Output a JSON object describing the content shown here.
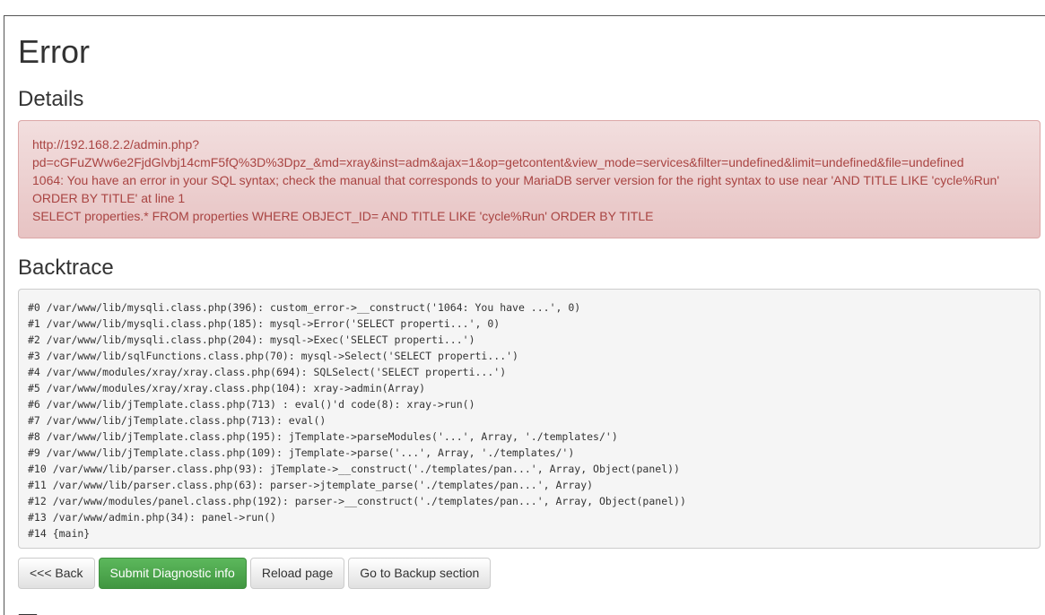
{
  "page": {
    "title": "Error",
    "details_heading": "Details",
    "backtrace_heading": "Backtrace",
    "next_heading_partial": "T"
  },
  "error_alert": {
    "url_line1": "http://192.168.2.2/admin.php?",
    "url_line2": "pd=cGFuZWw6e2FjdGlvbj14cmF5fQ%3D%3Dpz_&md=xray&inst=adm&ajax=1&op=getcontent&view_mode=services&filter=undefined&limit=undefined&file=undefined",
    "message_line1": "1064: You have an error in your SQL syntax; check the manual that corresponds to your MariaDB server version for the right syntax to use near 'AND TITLE LIKE 'cycle%Run'",
    "message_line2": "ORDER BY TITLE' at line 1",
    "query": "SELECT properties.* FROM properties WHERE OBJECT_ID= AND TITLE LIKE 'cycle%Run' ORDER BY TITLE"
  },
  "backtrace": [
    "#0 /var/www/lib/mysqli.class.php(396): custom_error->__construct('1064: You have ...', 0)",
    "#1 /var/www/lib/mysqli.class.php(185): mysql->Error('SELECT properti...', 0)",
    "#2 /var/www/lib/mysqli.class.php(204): mysql->Exec('SELECT properti...')",
    "#3 /var/www/lib/sqlFunctions.class.php(70): mysql->Select('SELECT properti...')",
    "#4 /var/www/modules/xray/xray.class.php(694): SQLSelect('SELECT properti...')",
    "#5 /var/www/modules/xray/xray.class.php(104): xray->admin(Array)",
    "#6 /var/www/lib/jTemplate.class.php(713) : eval()'d code(8): xray->run()",
    "#7 /var/www/lib/jTemplate.class.php(713): eval()",
    "#8 /var/www/lib/jTemplate.class.php(195): jTemplate->parseModules('...', Array, './templates/')",
    "#9 /var/www/lib/jTemplate.class.php(109): jTemplate->parse('...', Array, './templates/')",
    "#10 /var/www/lib/parser.class.php(93): jTemplate->__construct('./templates/pan...', Array, Object(panel))",
    "#11 /var/www/lib/parser.class.php(63): parser->jtemplate_parse('./templates/pan...', Array)",
    "#12 /var/www/modules/panel.class.php(192): parser->__construct('./templates/pan...', Array, Object(panel))",
    "#13 /var/www/admin.php(34): panel->run()",
    "#14 {main}"
  ],
  "buttons": {
    "back": "<<< Back",
    "submit": "Submit Diagnostic info",
    "reload": "Reload page",
    "backup": "Go to Backup section"
  },
  "colors": {
    "alert_text": "#a94442",
    "alert_bg": "#f2dede",
    "success": "#5cb85c"
  }
}
